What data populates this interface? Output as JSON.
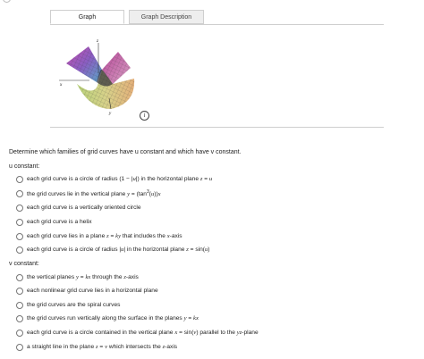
{
  "tabs": {
    "graph": "Graph",
    "description": "Graph Description"
  },
  "figure": {
    "axis_x": "x",
    "axis_y": "y",
    "axis_z": "z",
    "info": "i"
  },
  "question": "Determine which families of grid curves have u constant and which have v constant.",
  "u_section": {
    "label": "u constant:",
    "options": [
      "each grid curve is a circle of radius (1 − |u|) in the horizontal plane z = u",
      "the grid curves lie in the vertical plane y = (tan³(u))x",
      "each grid curve is a vertically oriented circle",
      "each grid curve is a helix",
      "each grid curve lies in a plane z = ky that includes the x-axis",
      "each grid curve is a circle of radius |u| in the horizontal plane z = sin(u)"
    ]
  },
  "v_section": {
    "label": "v constant:",
    "options": [
      "the vertical planes y = kx through the z-axis",
      "each nonlinear grid curve lies in a horizontal plane",
      "the grid curves are the spiral curves",
      "the grid curves run vertically along the surface in the planes y = kx",
      "each grid curve is a circle contained in the vertical plane x = sin(v) parallel to the yz-plane",
      "a straight line in the plane z = v which intersects the z-axis"
    ]
  },
  "colors": {
    "border": "#cfcfcf",
    "tab_inactive": "#eeeeee"
  }
}
